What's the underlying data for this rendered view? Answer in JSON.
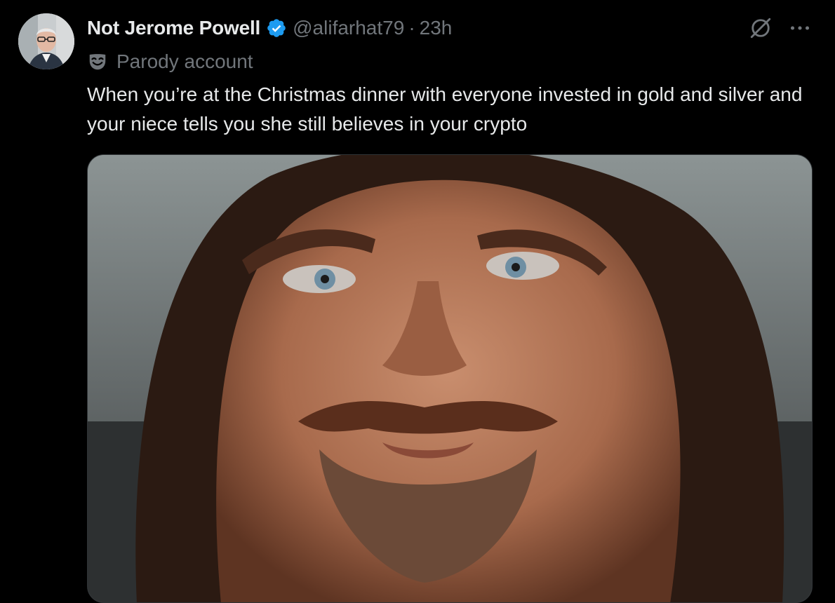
{
  "tweet": {
    "author": {
      "display_name": "Not Jerome Powell",
      "handle": "@alifarhat79",
      "separator": "·",
      "time": "23h",
      "verified": true,
      "account_label": "Parody account"
    },
    "text": "When you’re at the Christmas dinner with everyone invested in gold and silver and your niece tells you she still believes in your crypto",
    "icons": {
      "verified": "verified-badge-icon",
      "parody": "parody-mask-icon",
      "grok": "grok-icon",
      "more": "more-options-icon"
    }
  },
  "colors": {
    "background": "#000000",
    "primary_text": "#e7e9ea",
    "secondary_text": "#71767b",
    "verified_blue": "#1d9bf0",
    "border": "#2f3336"
  }
}
